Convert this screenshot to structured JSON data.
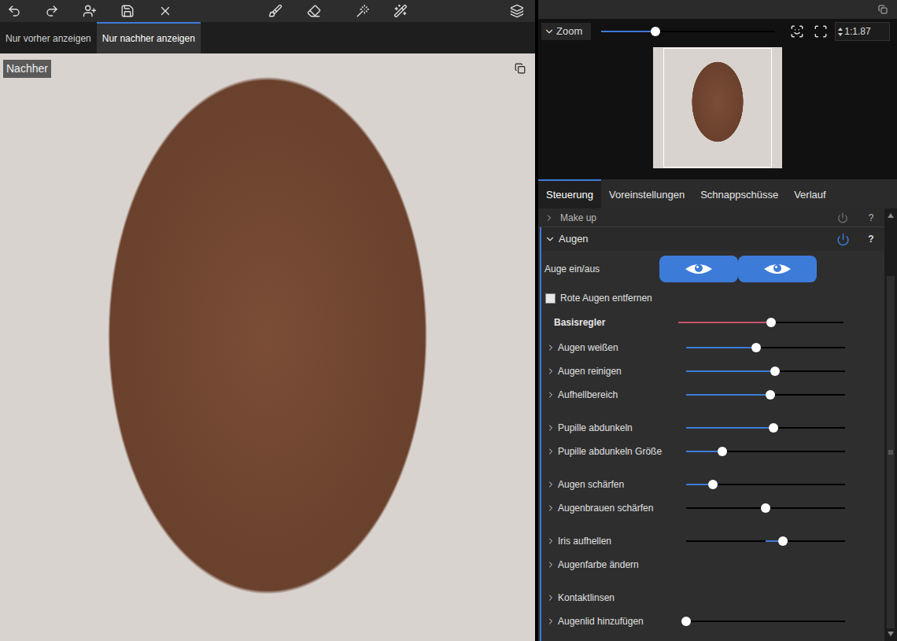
{
  "view_tabs": [
    {
      "label": "Nur vorher anzeigen",
      "selected": false
    },
    {
      "label": "Nur nachher anzeigen",
      "selected": true
    }
  ],
  "preview": {
    "badge": "Nachher"
  },
  "zoom": {
    "title": "Zoom",
    "expanded": true,
    "level": 0.31,
    "ratio": "1:1.87"
  },
  "panel_tabs": [
    {
      "label": "Steuerung",
      "selected": true
    },
    {
      "label": "Voreinstellungen",
      "selected": false
    },
    {
      "label": "Schnappschüsse",
      "selected": false
    },
    {
      "label": "Verlauf",
      "selected": false
    }
  ],
  "collapsed_section": {
    "title": "Make up",
    "enabled": false,
    "help": "?"
  },
  "eyes": {
    "title": "Augen",
    "expanded": true,
    "enabled": true,
    "help": "?",
    "toggle_label": "Auge ein/aus",
    "eye_buttons": [
      {
        "on": true
      },
      {
        "on": true
      }
    ],
    "red_eye": {
      "label": "Rote Augen entfernen",
      "checked": false
    },
    "master": {
      "label": "Basisregler",
      "level": 0.56
    },
    "groups": [
      [
        {
          "label": "Augen weißen",
          "kind": "slider",
          "level": 0.44
        },
        {
          "label": "Augen reinigen",
          "kind": "slider",
          "level": 0.56
        },
        {
          "label": "Aufhellbereich",
          "kind": "slider",
          "level": 0.53
        }
      ],
      [
        {
          "label": "Pupille abdunkeln",
          "kind": "slider",
          "level": 0.55
        },
        {
          "label": "Pupille abdunkeln Größe",
          "kind": "slider",
          "level": 0.23
        }
      ],
      [
        {
          "label": "Augen schärfen",
          "kind": "slider",
          "level": 0.17
        },
        {
          "label": "Augenbrauen schärfen",
          "kind": "bipolar",
          "level": 0.5
        }
      ],
      [
        {
          "label": "Iris aufhellen",
          "kind": "bipolar",
          "level": 0.61
        },
        {
          "label": "Augenfarbe ändern",
          "kind": "expander"
        }
      ],
      [
        {
          "label": "Kontaktlinsen",
          "kind": "expander"
        },
        {
          "label": "Augenlid hinzufügen",
          "kind": "slider",
          "level": 0
        }
      ]
    ]
  }
}
